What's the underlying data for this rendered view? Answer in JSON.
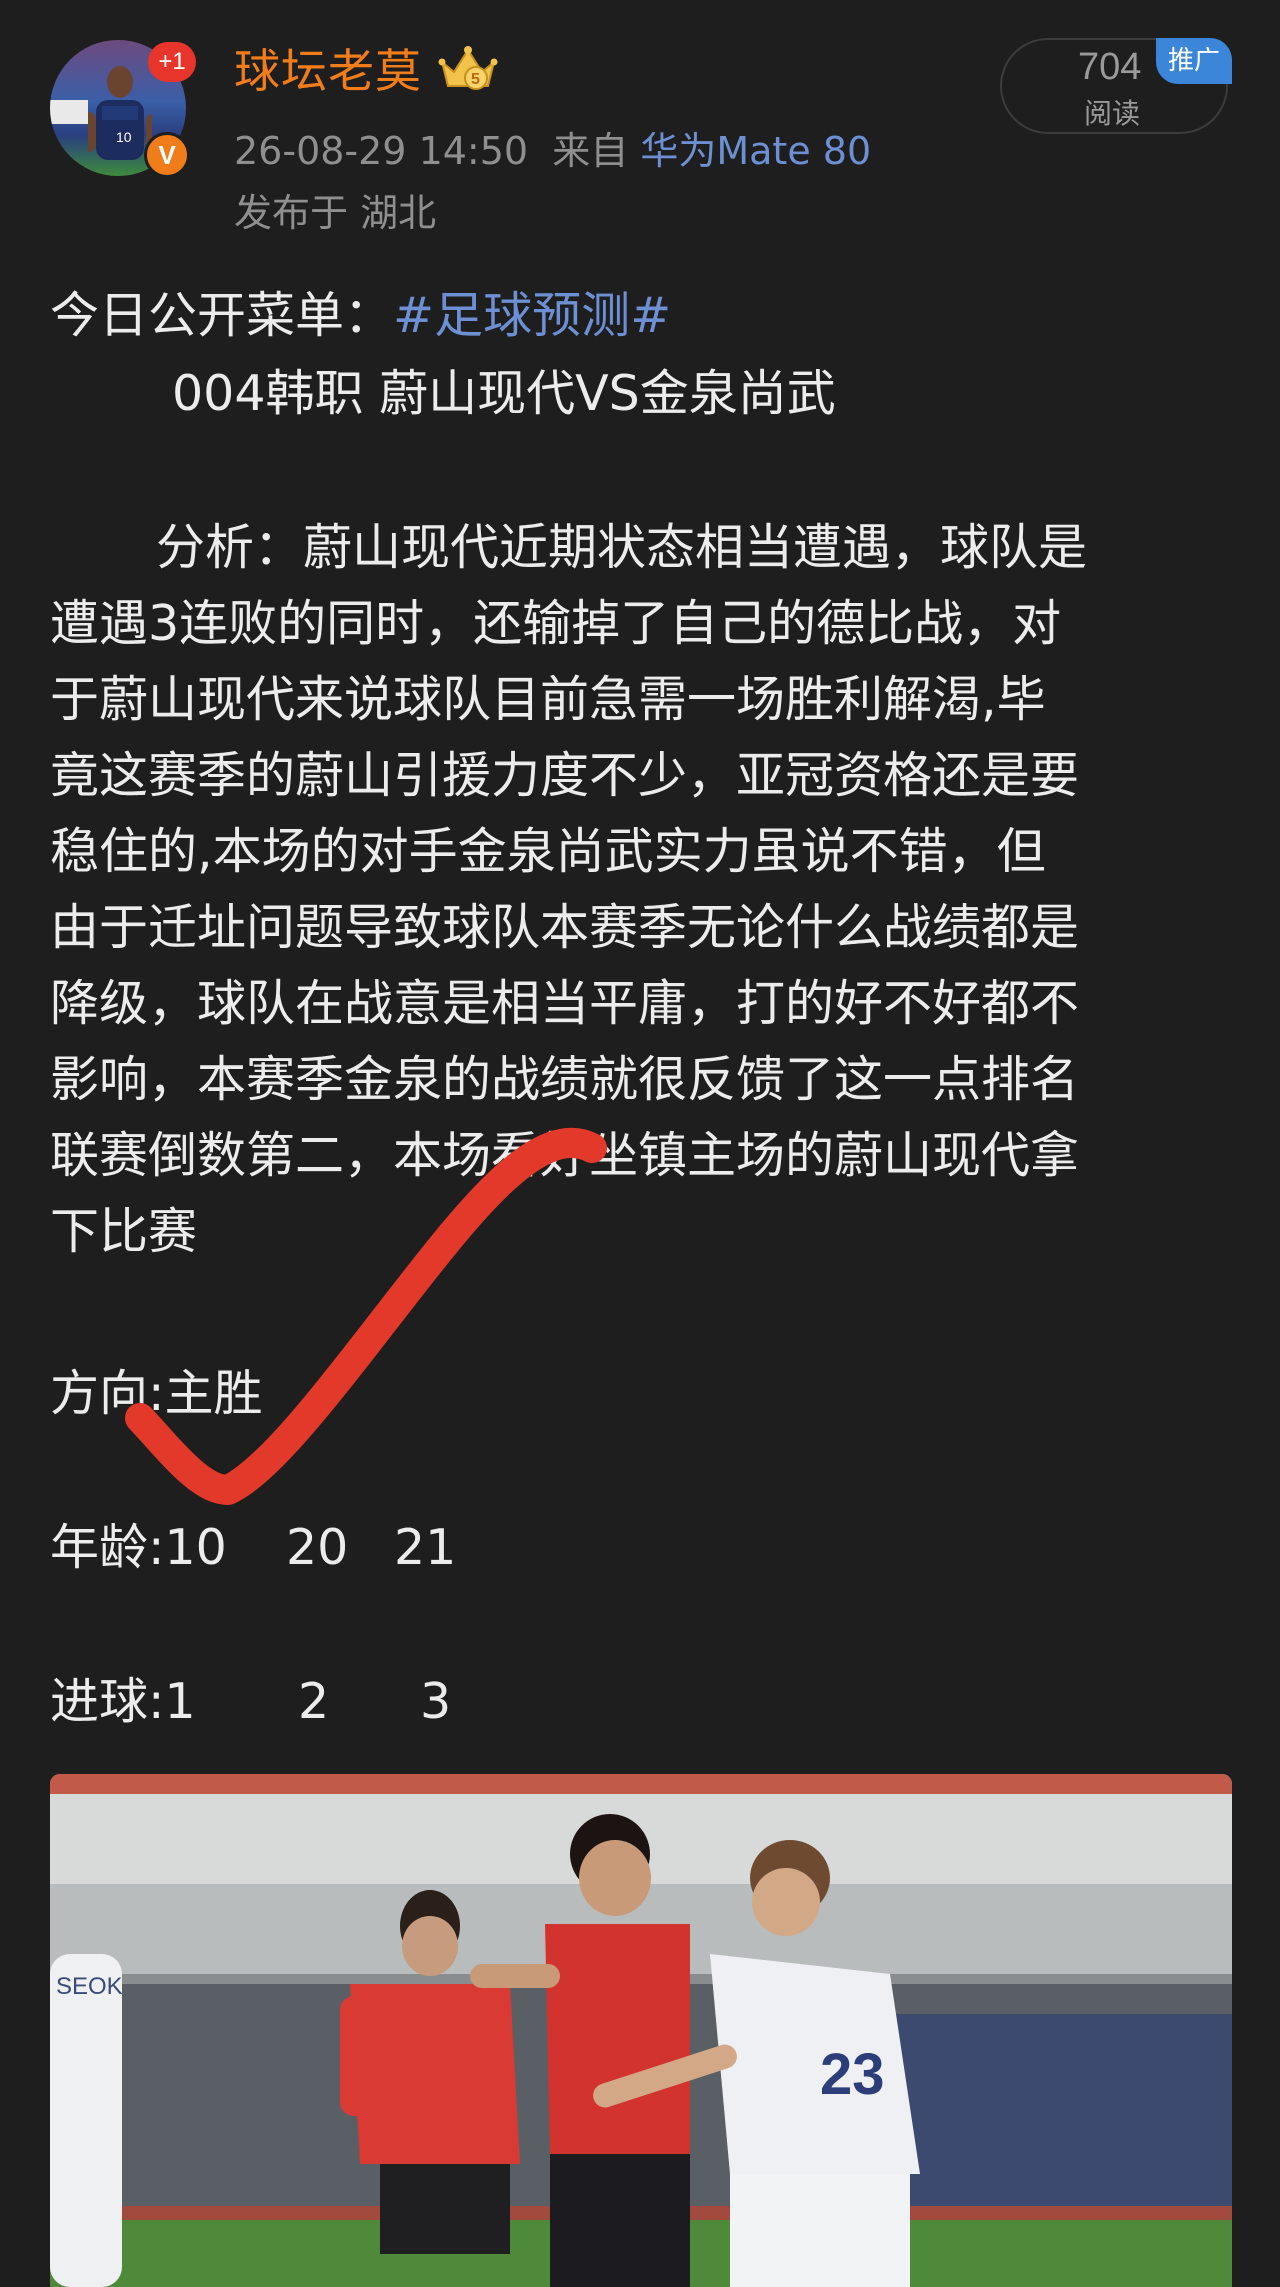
{
  "author": {
    "name": "球坛老莫",
    "avatar_badge": "+1",
    "verified_mark": "V",
    "crown_icon": "crown-level-5-icon",
    "crown_level": "5"
  },
  "post_meta": {
    "timestamp": "26-08-29 14:50",
    "source_prefix": "来自",
    "device": "华为Mate 80",
    "location": "发布于 湖北"
  },
  "reads": {
    "count": "704",
    "label": "阅读",
    "promo_tag": "推广"
  },
  "content": {
    "intro_prefix": "今日公开菜单：",
    "hashtag": "#足球预测#",
    "match_line": "004韩职 蔚山现代VS金泉尚武",
    "analysis_lines": [
      "分析：蔚山现代近期状态相当遭遇，球队是",
      "遭遇3连败的同时，还输掉了自己的德比战，对",
      "于蔚山现代来说球队目前急需一场胜利解渴,毕",
      "竟这赛季的蔚山引援力度不少，亚冠资格还是要",
      "稳住的,本场的对手金泉尚武实力虽说不错，但",
      "由于迁址问题导致球队本赛季无论什么战绩都是",
      "降级，球队在战意是相当平庸，打的好不好都不",
      "影响，本赛季金泉的战绩就很反馈了这一点排名",
      "联赛倒数第二，本场看好坐镇主场的蔚山现代拿",
      "下比赛"
    ],
    "direction": "方向:主胜",
    "age_label": "年龄:10",
    "age_value_2": "20",
    "age_value_3": "21",
    "goals_label": "进球:1",
    "goals_value_2": "2",
    "goals_value_3": "3"
  },
  "annotation": {
    "check_color": "#e3392a"
  },
  "photo": {
    "description_icon": "football-match-photo",
    "jersey_number": "23",
    "name_fragment": "SEOK"
  },
  "colors": {
    "background": "#1e1e1e",
    "username": "#f07d1a",
    "link": "#6d8fd3",
    "meta_text": "#8f8f8f",
    "body_text": "#ececec",
    "badge_red": "#e8352b",
    "promo_blue": "#3b86d9"
  }
}
